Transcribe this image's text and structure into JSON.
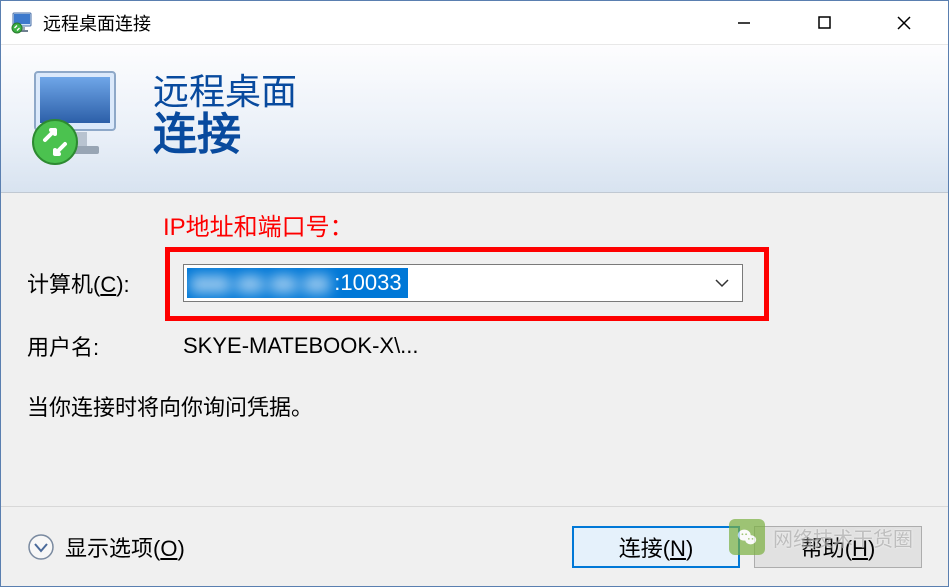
{
  "titlebar": {
    "title": "远程桌面连接"
  },
  "banner": {
    "line1": "远程桌面",
    "line2": "连接"
  },
  "annotation": {
    "label": "IP地址和端口号："
  },
  "form": {
    "computer_label": "计算机(C):",
    "computer_value_obscured": "▮▮▮.▮▮.▮▮.▮▮",
    "computer_value_port": ":10033",
    "username_label": "用户名:",
    "username_value": "SKYE-MATEBOOK-X\\..."
  },
  "info": {
    "text": "当你连接时将向你询问凭据。"
  },
  "footer": {
    "options_label": "显示选项(O)",
    "connect_label": "连接(N)",
    "help_label": "帮助(H)"
  },
  "watermark": {
    "text": "网络技术干货圈"
  }
}
